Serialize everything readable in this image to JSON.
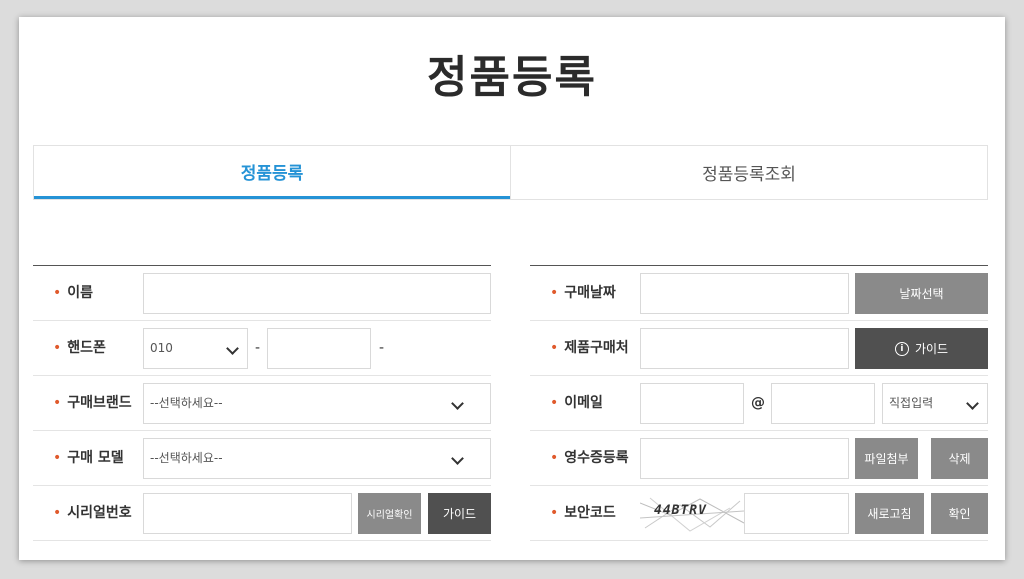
{
  "page": {
    "title": "정품등록"
  },
  "tabs": [
    {
      "label": "정품등록",
      "active": true
    },
    {
      "label": "정품등록조회",
      "active": false
    }
  ],
  "left_form": {
    "name": {
      "label": "이름"
    },
    "phone": {
      "label": "핸드폰",
      "prefix": "010",
      "dash1": "-",
      "dash2": "-"
    },
    "brand": {
      "label": "구매브랜드",
      "placeholder": "--선택하세요--"
    },
    "model": {
      "label": "구매 모델",
      "placeholder": "--선택하세요--"
    },
    "serial": {
      "label": "시리얼번호",
      "check_button": "시리얼확인",
      "guide_button": "가이드"
    }
  },
  "right_form": {
    "purchase_date": {
      "label": "구매날짜",
      "button": "날짜선택"
    },
    "store": {
      "label": "제품구매처",
      "guide_button": "가이드"
    },
    "email": {
      "label": "이메일",
      "at": "@",
      "domain_select": "직접입력"
    },
    "receipt": {
      "label": "영수증등록",
      "attach_button": "파일첨부",
      "delete_button": "삭제"
    },
    "security": {
      "label": "보안코드",
      "captcha": "44BTRV",
      "refresh_button": "새로고침",
      "confirm_button": "확인"
    }
  },
  "colors": {
    "accent": "#2593d6",
    "required_star": "#e05a2c",
    "btn_gray": "#8a8a8a",
    "btn_dark": "#505050"
  },
  "marks": {
    "required": "•"
  }
}
